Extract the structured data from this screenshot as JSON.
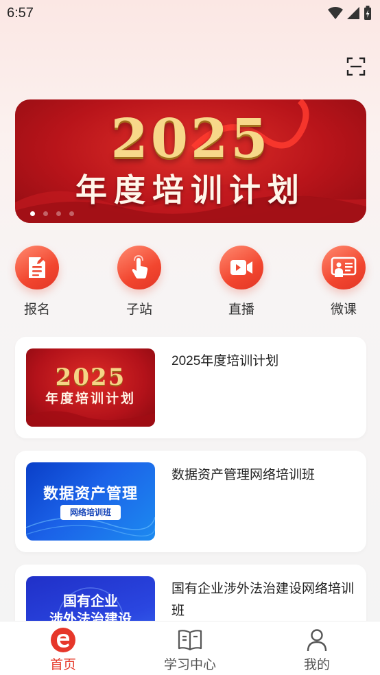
{
  "status_bar": {
    "time": "6:57"
  },
  "banner": {
    "year": "2025",
    "subtitle": "年度培训计划",
    "slide_count": 4,
    "active_slide": 1
  },
  "quick_nav": [
    {
      "label": "报名",
      "icon": "signup-document-icon"
    },
    {
      "label": "子站",
      "icon": "tap-hand-icon"
    },
    {
      "label": "直播",
      "icon": "live-video-icon"
    },
    {
      "label": "微课",
      "icon": "micro-lesson-icon"
    }
  ],
  "courses": [
    {
      "title": "2025年度培训计划",
      "thumb": {
        "line1": "2025",
        "line2": "年度培训计划"
      }
    },
    {
      "title": "数据资产管理网络培训班",
      "thumb": {
        "line1": "数据资产管理",
        "line2": "网络培训班"
      }
    },
    {
      "title": "国有企业涉外法治建设网络培训班",
      "thumb": {
        "line1": "国有企业",
        "line2": "涉外法治建设"
      }
    }
  ],
  "bottom_nav": [
    {
      "label": "首页",
      "icon": "home-e-logo-icon",
      "active": true
    },
    {
      "label": "学习中心",
      "icon": "open-book-icon",
      "active": false
    },
    {
      "label": "我的",
      "icon": "user-icon",
      "active": false
    }
  ],
  "colors": {
    "accent": "#e63a2a",
    "icon_gradient_start": "#ff8a70",
    "icon_gradient_end": "#e23626"
  }
}
